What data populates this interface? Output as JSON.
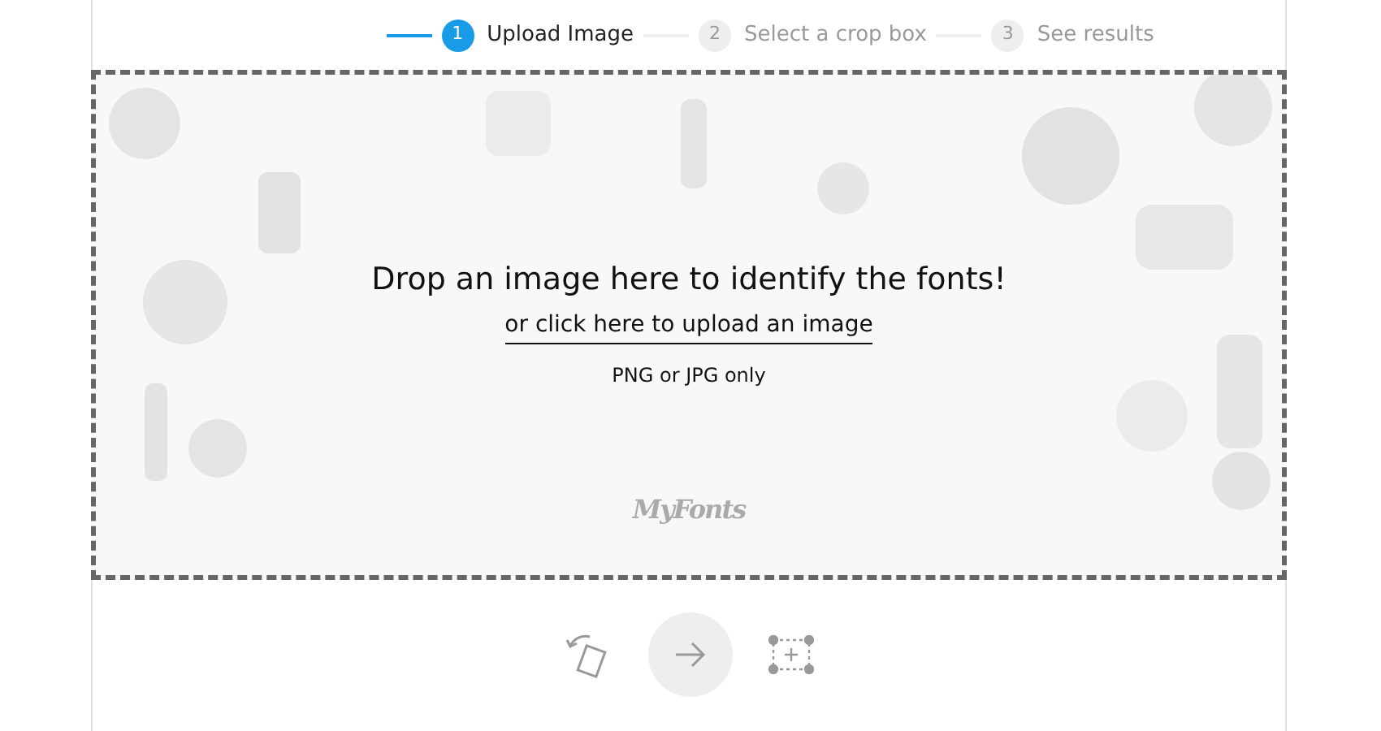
{
  "steps": [
    {
      "number": "1",
      "label": "Upload Image",
      "selected": true
    },
    {
      "number": "2",
      "label": "Select a crop box",
      "selected": false
    },
    {
      "number": "3",
      "label": "See results",
      "selected": false
    }
  ],
  "dropzone": {
    "title": "Drop an image here to identify the fonts!",
    "link": "or click here to upload an image",
    "hint": "PNG or JPG only",
    "logo": "MyFonts"
  },
  "toolbar": {
    "buttons": [
      {
        "kind": "rotate"
      },
      {
        "kind": "next"
      },
      {
        "kind": "crop"
      }
    ]
  }
}
